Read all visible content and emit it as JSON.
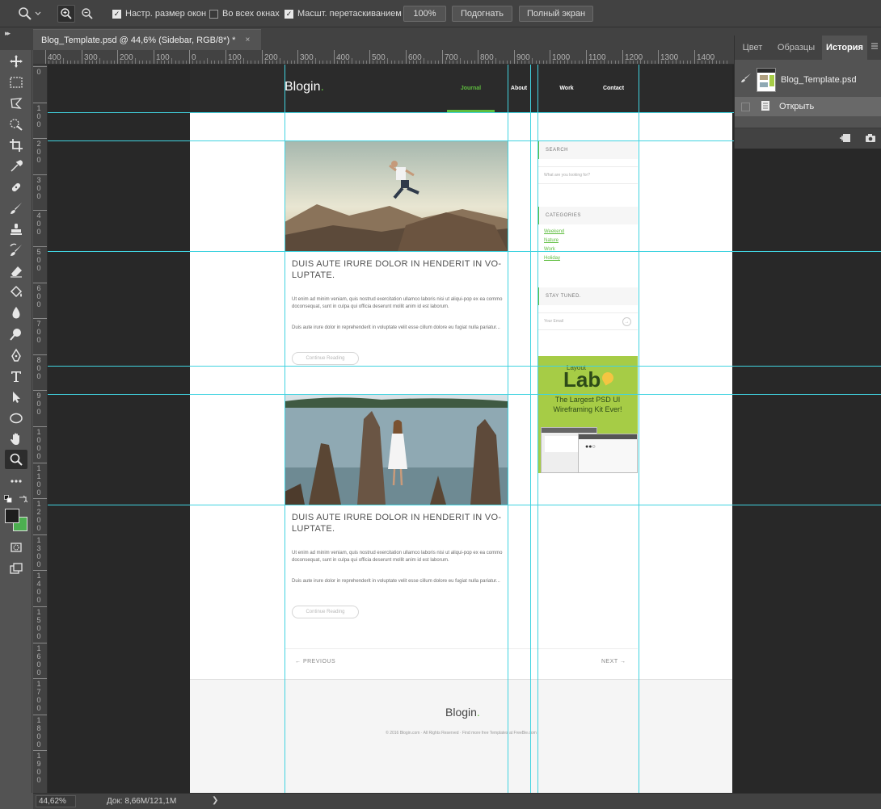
{
  "options_bar": {
    "checkbox_resize": "Настр. размер окон",
    "checkbox_all_windows": "Во всех окнах",
    "checkbox_scrubby": "Масшт. перетаскиванием",
    "btn_100": "100%",
    "btn_fit": "Подогнать",
    "btn_fullscreen": "Полный экран"
  },
  "document_tab": {
    "title": "Blog_Template.psd @ 44,6% (Sidebar, RGB/8*) *",
    "close": "×"
  },
  "ruler_top": [
    "400",
    "300",
    "200",
    "100",
    "0",
    "100",
    "200",
    "300",
    "400",
    "500",
    "600",
    "700",
    "800",
    "900",
    "1000",
    "1100",
    "1200",
    "1300",
    "1400"
  ],
  "ruler_left": [
    "0",
    "1\n0\n0",
    "2\n0\n0",
    "3\n0\n0",
    "4\n0\n0",
    "5\n0\n0",
    "6\n0\n0",
    "7\n0\n0",
    "8\n0\n0",
    "9\n0\n0",
    "1\n0\n0\n0",
    "1\n1\n0\n0",
    "1\n2\n0\n0",
    "1\n3\n0\n0",
    "1\n4\n0\n0",
    "1\n5\n0\n0",
    "1\n6\n0\n0",
    "1\n7\n0\n0",
    "1\n8\n0\n0",
    "1\n9\n0\n0"
  ],
  "page": {
    "logo": "Blogin",
    "logo_dot": ".",
    "nav": [
      "Journal",
      "About",
      "Work",
      "Contact"
    ],
    "post1": {
      "title": "DUIS AUTE IRURE DOLOR IN HENDERIT IN VO-LUPTATE.",
      "p1": "Ut enim ad minim veniam, quis nostrud exercitation ullamco laboris nisi ut aliqui-pop ex ea commo doconsequat, sunt in culpa qui officia deserunt mollit anim id est laborum.",
      "p2": "Duis aute irure dolor in reprehenderit in voluptate velit esse cillum dolore eu fugiat nulla pariatur...",
      "button": "Continue Reading"
    },
    "post2": {
      "title": "DUIS AUTE IRURE DOLOR IN HENDERIT IN VO-LUPTATE.",
      "p1": "Ut enim ad minim veniam, quis nostrud exercitation ullamco laboris nisi ut aliqui-pop ex ea commo doconsequat, sunt in culpa qui officia deserunt mollit anim id est laborum.",
      "p2": "Duis aute irure dolor in reprehenderit in voluptate velit esse cillum dolore eu fugiat nulla pariatur...",
      "button": "Continue Reading"
    },
    "sidebar": {
      "search_title": "SEARCH",
      "search_placeholder": "What are you looking for?",
      "categories_title": "CATEGORIES",
      "categories": [
        "Weekend",
        "Nature",
        "Work",
        "Holiday"
      ],
      "stay_title": "STAY TUNED.",
      "email_placeholder": "Your Email",
      "ad_brand": "Layout",
      "ad_brand_big": "Lab",
      "ad_tagline": "The Largest PSD UI Wireframing Kit Ever!"
    },
    "pager": {
      "prev": "←  PREVIOUS",
      "next": "NEXT  →"
    },
    "footer": {
      "logo": "Blogin",
      "logo_dot": ".",
      "copyright": "© 2016 Blogin.com  ·  All Rights Reserved  ·  Find more free Templates at FreeBie.com"
    }
  },
  "status_bar": {
    "zoom": "44,62%",
    "doc_info": "Док: 8,66M/121,1M",
    "arrow": "❯"
  },
  "panel": {
    "tabs": [
      "Цвет",
      "Образцы",
      "История"
    ],
    "snapshot_label": "Blog_Template.psd",
    "history_item": "Открыть"
  },
  "colors": {
    "guide": "#41d3e0",
    "accent_green": "#5ebd3e",
    "foreground_swatch": "#1e1e1e",
    "background_swatch": "#4caf50"
  }
}
